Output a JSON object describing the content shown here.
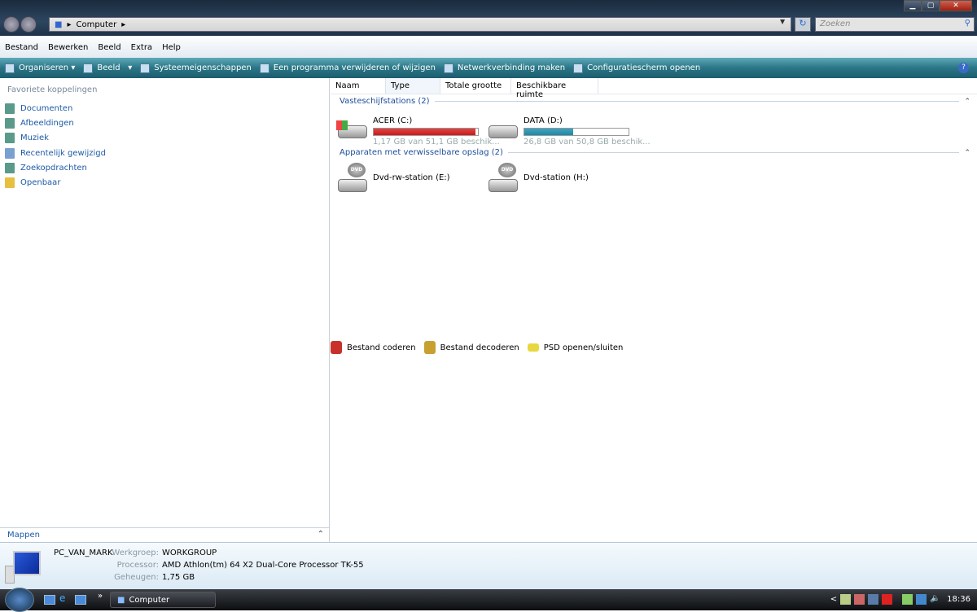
{
  "window": {
    "minimize": "▁",
    "maximize": "▢",
    "close": "✕"
  },
  "address": {
    "root": "Computer",
    "search_placeholder": "Zoeken"
  },
  "menu": {
    "items": [
      "Bestand",
      "Bewerken",
      "Beeld",
      "Extra",
      "Help"
    ],
    "extras": [
      {
        "label": "Bestand coderen",
        "color": "#c8302a"
      },
      {
        "label": "Bestand decoderen",
        "color": "#c8a030"
      },
      {
        "label": "PSD openen/sluiten",
        "color": "#e8d840"
      }
    ]
  },
  "toolbar": {
    "items": [
      "Organiseren",
      "Beeld",
      "Systeemeigenschappen",
      "Een programma verwijderen of wijzigen",
      "Netwerkverbinding maken",
      "Configuratiescherm openen"
    ],
    "help": "?"
  },
  "sidebar": {
    "title": "Favoriete koppelingen",
    "items": [
      "Documenten",
      "Afbeeldingen",
      "Muziek",
      "Recentelijk gewijzigd",
      "Zoekopdrachten",
      "Openbaar"
    ],
    "folders": "Mappen"
  },
  "columns": [
    "Naam",
    "Type",
    "Totale grootte",
    "Beschikbare ruimte"
  ],
  "groups": [
    {
      "title": "Vasteschijfstations (2)",
      "drives": [
        {
          "name": "ACER (C:)",
          "info": "1,17 GB van 51,1 GB beschik...",
          "used_fraction": 0.977,
          "bar_color": "#d01818"
        },
        {
          "name": "DATA (D:)",
          "info": "26,8 GB van 50,8 GB beschik...",
          "used_fraction": 0.47,
          "bar_color": "#1a8aaa"
        }
      ]
    },
    {
      "title": "Apparaten met verwisselbare opslag (2)",
      "drives": [
        {
          "name": "Dvd-rw-station (E:)",
          "badge": "DVD"
        },
        {
          "name": "Dvd-station (H:)",
          "badge": "DVD"
        }
      ]
    }
  ],
  "details": {
    "computer": "PC_VAN_MARK",
    "workgroup_label": "Werkgroep:",
    "workgroup": "WORKGROUP",
    "processor_label": "Processor:",
    "processor": "AMD Athlon(tm) 64 X2 Dual-Core Processor TK-55",
    "memory_label": "Geheugen:",
    "memory": "1,75 GB"
  },
  "taskbar": {
    "window": "Computer",
    "clock": "18:36",
    "overflow": "»",
    "tray_expand": "<"
  }
}
